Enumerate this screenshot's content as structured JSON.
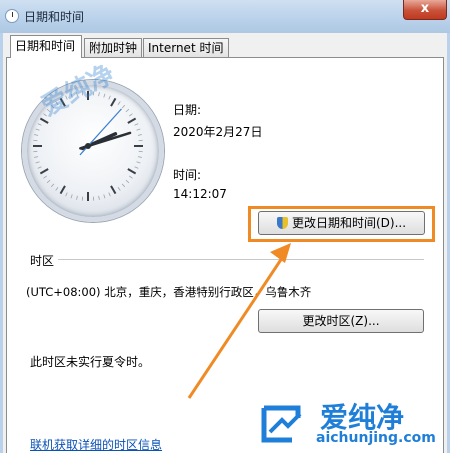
{
  "window": {
    "title": "日期和时间",
    "close_symbol": "x"
  },
  "tabs": [
    "日期和时间",
    "附加时钟",
    "Internet 时间"
  ],
  "date": {
    "label": "日期:",
    "value": "2020年2月27日"
  },
  "time": {
    "label": "时间:",
    "value": "14:12:07"
  },
  "clock": {
    "hour": 14,
    "minute": 12,
    "second": 7
  },
  "change_datetime_button": "更改日期和时间(D)...",
  "timezone": {
    "group_label": "时区",
    "value": "(UTC+08:00) 北京，重庆，香港特别行政区，乌鲁木齐",
    "change_button": "更改时区(Z)...",
    "dst_note": "此时区未实行夏令时。"
  },
  "link": "联机获取详细的时区信息",
  "watermark": {
    "text": "爱纯净",
    "url": "aichunjing.com"
  },
  "colors": {
    "highlight": "#f08a24",
    "link": "#0b52b5"
  }
}
